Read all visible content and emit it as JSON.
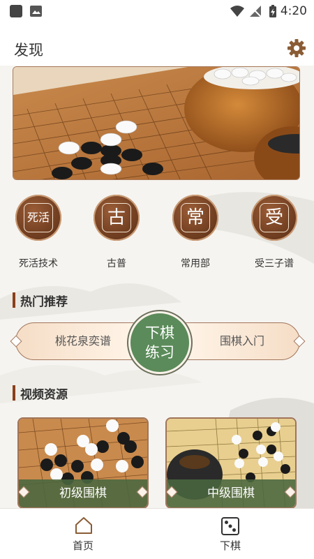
{
  "status_bar": {
    "time": "4:20"
  },
  "header": {
    "title": "发现"
  },
  "categories": [
    {
      "char": "死活",
      "label": "死活技术"
    },
    {
      "char": "古",
      "label": "古普"
    },
    {
      "char": "常",
      "label": "常用部"
    },
    {
      "char": "受",
      "label": "受三子谱"
    }
  ],
  "sections": {
    "hot": "热门推荐",
    "video": "视频资源"
  },
  "recommend": {
    "left": "桃花泉奕谱",
    "center_line1": "下棋",
    "center_line2": "练习",
    "right": "围棋入门"
  },
  "videos": [
    {
      "label": "初级围棋"
    },
    {
      "label": "中级围棋"
    }
  ],
  "bottom_nav": [
    {
      "label": "首页",
      "icon": "home-icon"
    },
    {
      "label": "下棋",
      "icon": "dice-icon"
    }
  ],
  "colors": {
    "accent": "#8a3f1c",
    "green": "#5b8b5a",
    "brown": "#6b3a1e"
  }
}
